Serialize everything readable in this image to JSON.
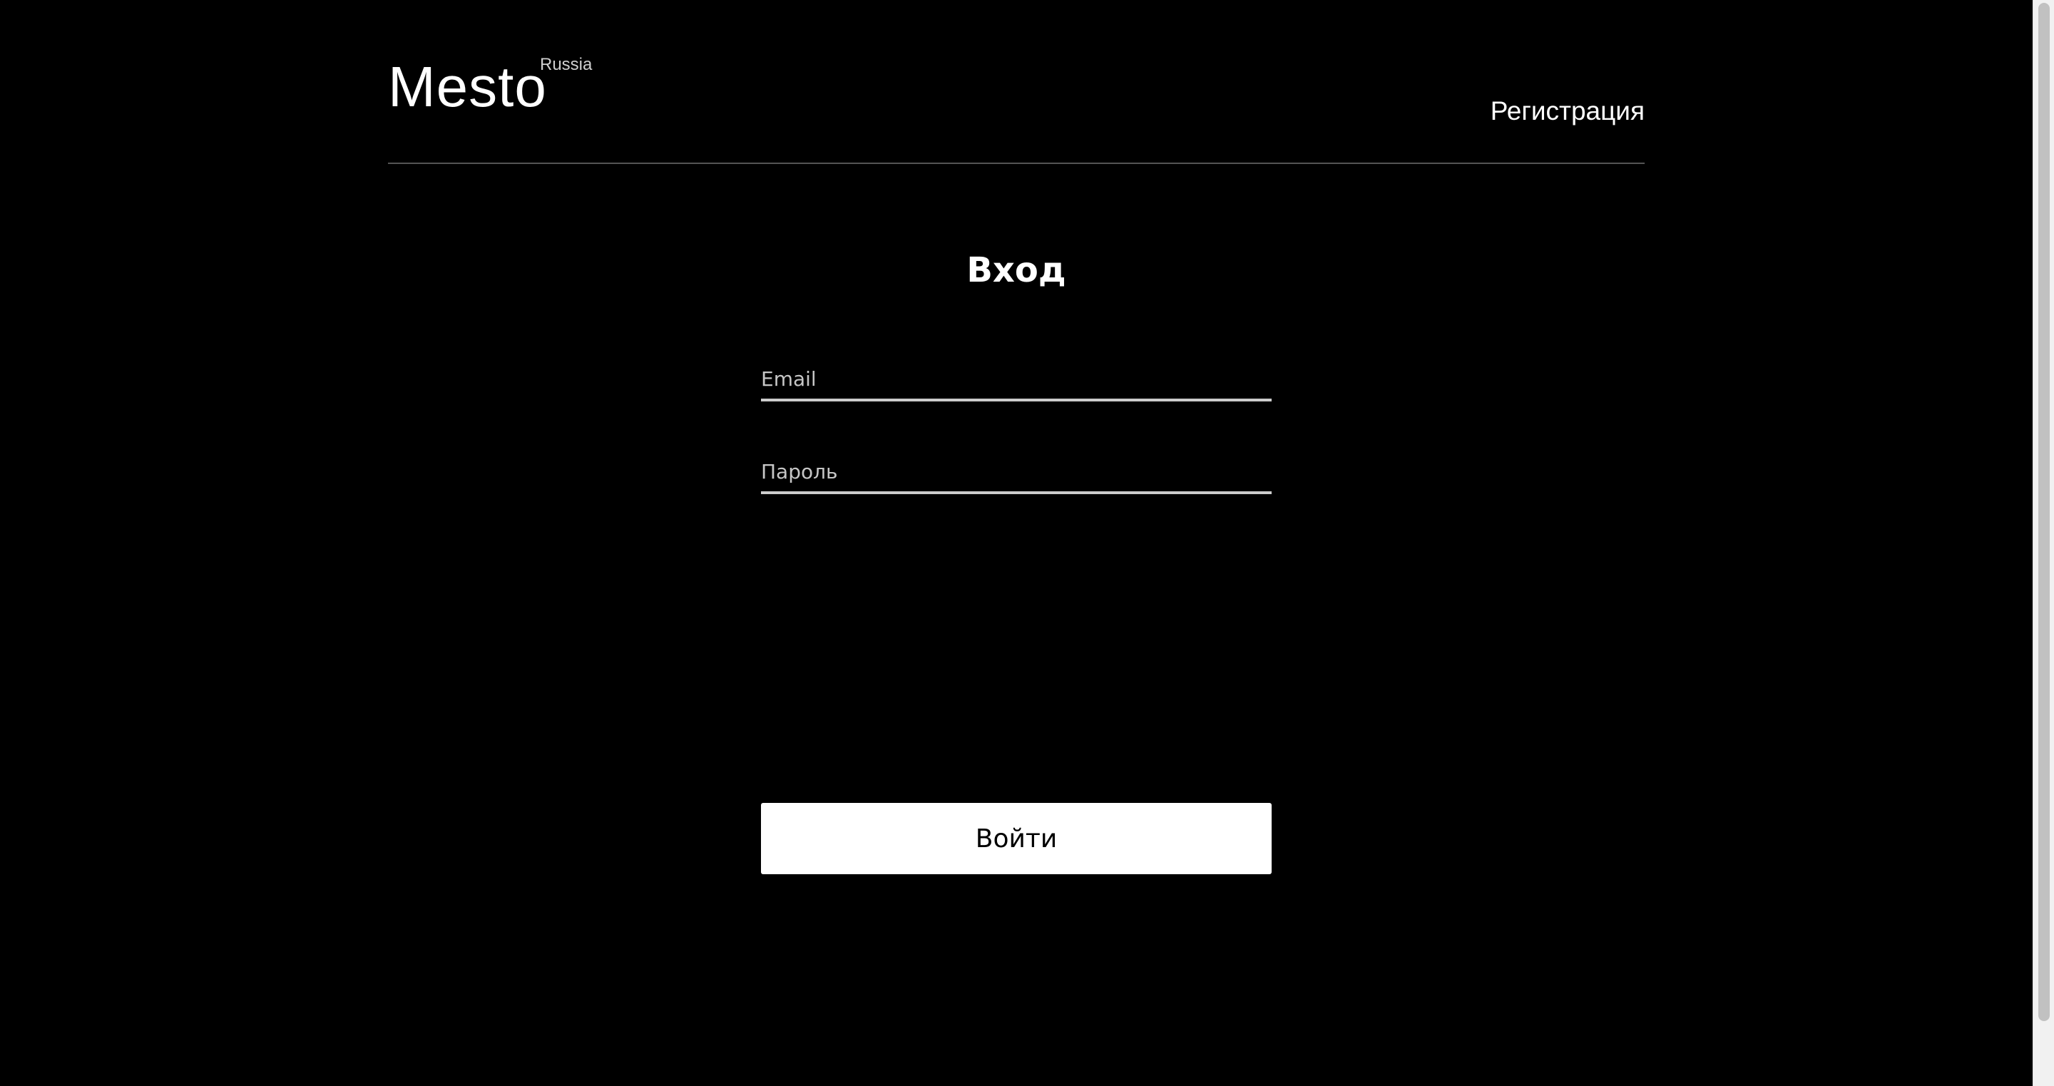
{
  "header": {
    "logo_text": "Mesto",
    "logo_superscript": "Russia",
    "nav_link_label": "Регистрация"
  },
  "login": {
    "title": "Вход",
    "email_placeholder": "Email",
    "email_value": "",
    "password_placeholder": "Пароль",
    "password_value": "",
    "submit_label": "Войти"
  },
  "colors": {
    "background": "#000000",
    "text": "#ffffff",
    "divider": "#545454",
    "button_background": "#ffffff",
    "button_text": "#000000"
  }
}
